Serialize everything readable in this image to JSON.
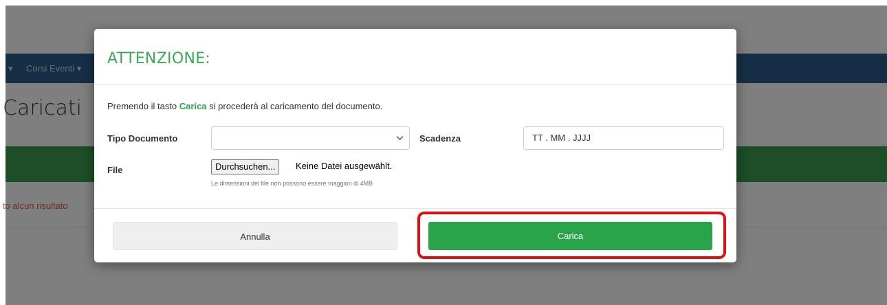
{
  "background": {
    "nav_items": [
      "Corsi Eventi"
    ],
    "page_heading": "Caricati",
    "no_result_text": "to alcun risultato"
  },
  "modal": {
    "title": "ATTENZIONE:",
    "intro_before": "Premendo il tasto ",
    "intro_keyword": "Carica",
    "intro_after": " si procederà al caricamento del documento.",
    "tipo_label": "Tipo Documento",
    "tipo_value": "",
    "scadenza_label": "Scadenza",
    "scadenza_placeholder": "TT . MM . JJJJ",
    "file_label": "File",
    "file_button": "Durchsuchen...",
    "file_status": "Keine Datei ausgewählt.",
    "file_help": "Le dimensioni del file non possono essere maggiori di 4MB",
    "cancel_label": "Annulla",
    "submit_label": "Carica"
  },
  "colors": {
    "accent_green": "#2aa44a",
    "highlight_red": "#e01010",
    "navbar_blue": "#2c5c8a"
  }
}
